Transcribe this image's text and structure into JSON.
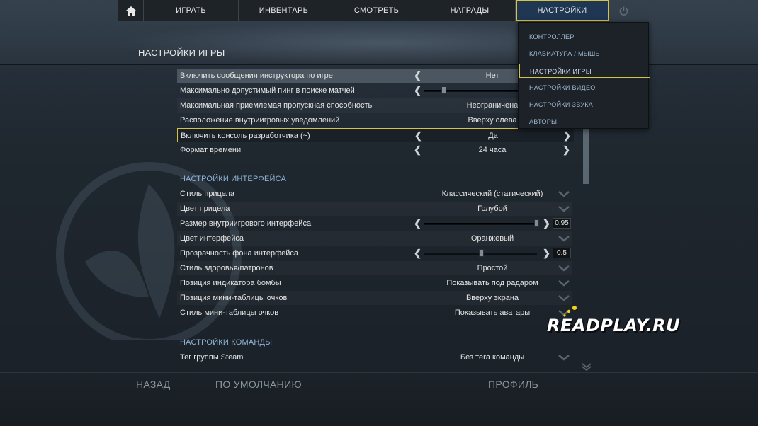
{
  "nav": {
    "items": [
      "ИГРАТЬ",
      "ИНВЕНТАРЬ",
      "СМОТРЕТЬ",
      "НАГРАДЫ",
      "НАСТРОЙКИ"
    ],
    "active": "НАСТРОЙКИ",
    "home_icon": "home-icon",
    "power_icon": "power-icon"
  },
  "settings_menu": {
    "items": [
      "КОНТРОЛЛЕР",
      "КЛАВИАТУРА / МЫШЬ",
      "НАСТРОЙКИ ИГРЫ",
      "НАСТРОЙКИ ВИДЕО",
      "НАСТРОЙКИ ЗВУКА",
      "АВТОРЫ"
    ],
    "selected": "НАСТРОЙКИ ИГРЫ"
  },
  "page_title": "НАСТРОЙКИ ИГРЫ",
  "game_settings": [
    {
      "label": "Включить сообщения инструктора по игре",
      "value": "Нет",
      "control": "arrows"
    },
    {
      "label": "Максимально допустимый пинг в поиске матчей",
      "value": "",
      "control": "slider",
      "level": 0.17
    },
    {
      "label": "Максимальная приемлемая пропускная способность",
      "value": "Неограничена",
      "control": "arrows"
    },
    {
      "label": "Расположение внутриигровых уведомлений",
      "value": "Вверху слева",
      "control": "arrows"
    },
    {
      "label": "Включить консоль разработчика (~)",
      "value": "Да",
      "control": "arrows"
    },
    {
      "label": "Формат времени",
      "value": "24 часа",
      "control": "arrows"
    }
  ],
  "interface_group": {
    "title": "НАСТРОЙКИ ИНТЕРФЕЙСА",
    "rows": [
      {
        "label": "Стиль прицела",
        "value": "Классический (статический)",
        "control": "dropdown"
      },
      {
        "label": "Цвет прицела",
        "value": "Голубой",
        "control": "dropdown"
      },
      {
        "label": "Размер внутриигрового интерфейса",
        "value": "0.95",
        "control": "slider",
        "level": 0.95
      },
      {
        "label": "Цвет интерфейса",
        "value": "Оранжевый",
        "control": "dropdown"
      },
      {
        "label": "Прозрачность фона интерфейса",
        "value": "0.5",
        "control": "slider",
        "level": 0.5
      },
      {
        "label": "Стиль здоровья/патронов",
        "value": "Простой",
        "control": "dropdown"
      },
      {
        "label": "Позиция индикатора бомбы",
        "value": "Показывать под радаром",
        "control": "dropdown"
      },
      {
        "label": "Позиция мини-таблицы очков",
        "value": "Вверху экрана",
        "control": "dropdown"
      },
      {
        "label": "Стиль мини-таблицы очков",
        "value": "Показывать аватары",
        "control": "dropdown"
      }
    ]
  },
  "team_group": {
    "title": "НАСТРОЙКИ КОМАНДЫ",
    "rows": [
      {
        "label": "Тег группы Steam",
        "value": "Без тега команды",
        "control": "dropdown"
      }
    ]
  },
  "footer": {
    "back": "НАЗАД",
    "defaults": "ПО УМОЛЧАНИЮ",
    "profile": "ПРОФИЛЬ"
  },
  "watermark": "READPLAY.RU",
  "colors": {
    "accent_outline": "#d6c246",
    "menu_text": "#9fb9d2",
    "group_title": "#8fb4d6"
  }
}
